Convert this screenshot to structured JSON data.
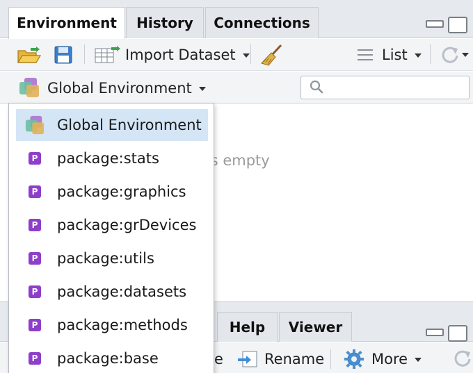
{
  "tabs": [
    {
      "label": "Environment",
      "active": true
    },
    {
      "label": "History",
      "active": false
    },
    {
      "label": "Connections",
      "active": false
    }
  ],
  "toolbar": {
    "import_dataset": "Import Dataset",
    "view_mode": "List",
    "environment_selector": "Global Environment"
  },
  "environment": {
    "empty_message_visible": "nment is empty"
  },
  "dropdown": {
    "items": [
      {
        "label": "Global Environment",
        "icon": "global-environment-icon",
        "selected": true
      },
      {
        "label": "package:stats",
        "icon": "package-icon",
        "selected": false
      },
      {
        "label": "package:graphics",
        "icon": "package-icon",
        "selected": false
      },
      {
        "label": "package:grDevices",
        "icon": "package-icon",
        "selected": false
      },
      {
        "label": "package:utils",
        "icon": "package-icon",
        "selected": false
      },
      {
        "label": "package:datasets",
        "icon": "package-icon",
        "selected": false
      },
      {
        "label": "package:methods",
        "icon": "package-icon",
        "selected": false
      },
      {
        "label": "package:base",
        "icon": "package-icon",
        "selected": false
      }
    ],
    "package_glyph": "P"
  },
  "bottom_tabs": [
    {
      "label": "Help"
    },
    {
      "label": "Viewer"
    }
  ],
  "bottom_toolbar": {
    "partial_label": "e",
    "rename": "Rename",
    "more": "More"
  },
  "colors": {
    "accent_selected": "#d4e5f6",
    "package_icon": "#8e3ec9",
    "tab_bar": "#e6e9ed",
    "toolbar": "#f2f4f6"
  }
}
